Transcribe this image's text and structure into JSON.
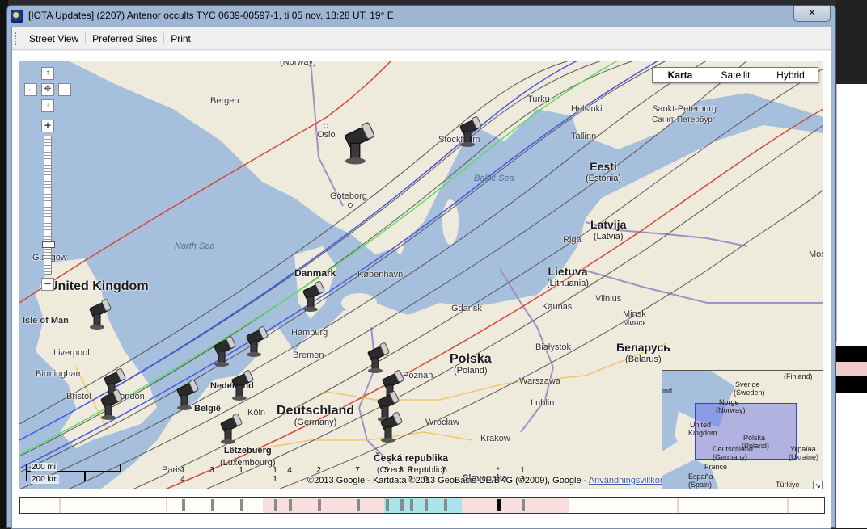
{
  "window": {
    "title": "[IOTA Updates] (2207) Antenor occults TYC 0639-00597-1, ti 05 nov, 18:28 UT, 19° E",
    "close_label": "✕"
  },
  "toolbar": {
    "items": [
      "Street View",
      "Preferred Sites",
      "Print"
    ]
  },
  "map": {
    "map_types": [
      "Karta",
      "Satellit",
      "Hybrid"
    ],
    "selected_map_type": "Karta",
    "pan_controls": {
      "up": "↑",
      "left": "←",
      "center": "✥",
      "right": "→",
      "down": "↓"
    },
    "zoom": {
      "in_label": "+",
      "out_label": "−",
      "level_fraction": 0.2
    },
    "scale": {
      "miles": "200 mi",
      "km": "200 km"
    },
    "copyright_text": "©2013 Google - Kartdata ©2013 GeoBasis-DE/BKG (©2009), Google - ",
    "terms_link": "Användningsvillkor",
    "countries": [
      {
        "name": "United Kingdom",
        "sub": ""
      },
      {
        "name": "Danmark",
        "sub": ""
      },
      {
        "name": "Polska",
        "sub": "(Poland)"
      },
      {
        "name": "Deutschland",
        "sub": "(Germany)"
      },
      {
        "name": "Eesti",
        "sub": "(Estonia)"
      },
      {
        "name": "Latvija",
        "sub": "(Latvia)"
      },
      {
        "name": "Lietuva",
        "sub": "(Lithuania)"
      },
      {
        "name": "Беларусь",
        "sub": "(Belarus)"
      },
      {
        "name": "Česká republika",
        "sub": "(Czech Republic)"
      },
      {
        "name": "Nederland",
        "sub": "(Netherlands)"
      },
      {
        "name": "België",
        "sub": "(Belgique)"
      },
      {
        "name": "Lëtzebuerg",
        "sub": "(Luxembourg)"
      },
      {
        "name": "(Norway)",
        "sub": ""
      }
    ],
    "cities": [
      "Bergen",
      "Oslo",
      "Stockholm",
      "Göteborg",
      "Turku",
      "Helsinki",
      "Sankt-Peterburg",
      "Санкт-Петербург",
      "Tallinn",
      "Riga",
      "København",
      "Hamburg",
      "Bremen",
      "Gdansk",
      "Kaunas",
      "Vilnius",
      "Minsk",
      "Минск",
      "Białystok",
      "Warszawa",
      "Poznań",
      "Lublin",
      "Wrocław",
      "Kraków",
      "Köln",
      "Liverpool",
      "Birmingham",
      "Bristol",
      "London",
      "Glasgow",
      "Isle of Man",
      "Paris",
      "Slovensko",
      "Mos"
    ],
    "water": [
      "North Sea",
      "Baltic Sea"
    ],
    "overview": {
      "places": [
        "Sverige",
        "(Sweden)",
        "(Finland)",
        "Norge",
        "(Norway)",
        "United",
        "Kingdom",
        "Polska",
        "(Poland)",
        "Deutschland",
        "(Germany)",
        "Україна",
        "(Ukraine)",
        "France",
        "España",
        "(Spain)",
        "Türkiye",
        "ind"
      ],
      "toggle_label": "↘"
    },
    "colors": {
      "central_line": "#5fdc5f",
      "shadow_edge": "#4a55e0",
      "sigma_limit": "#d8463a",
      "grid_line": "#555555",
      "water": "#a5bfdd",
      "land": "#eeeadc"
    }
  },
  "timeline": {
    "labels": [
      "1",
      "4",
      "3",
      "1",
      "1",
      "1",
      "4",
      "2",
      "7",
      "5",
      "8",
      "1",
      "7",
      "1",
      "0",
      "6",
      "*",
      "1",
      "3"
    ]
  }
}
